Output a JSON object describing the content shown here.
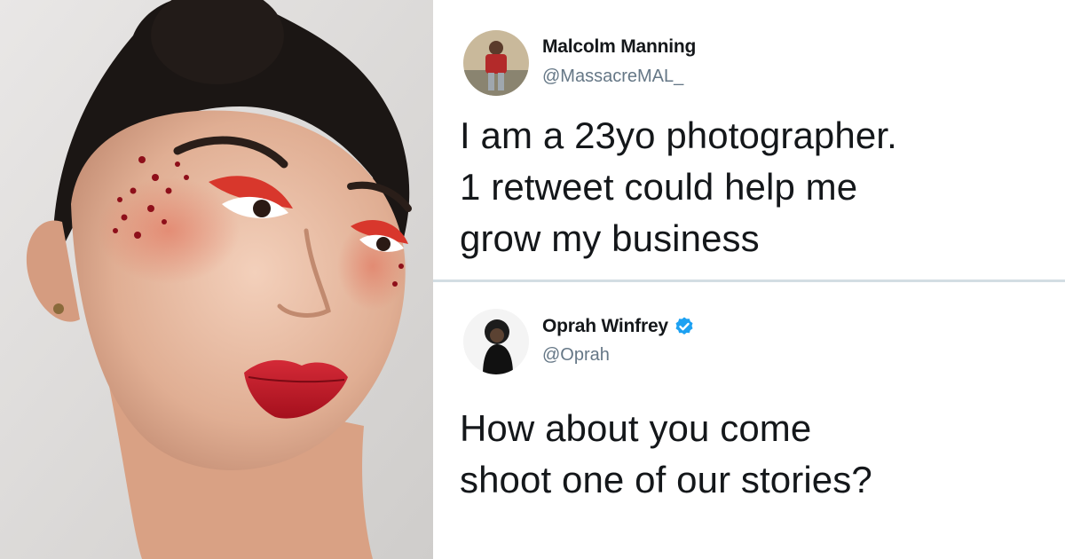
{
  "photo": {
    "description_icon": "portrait-photo"
  },
  "tweets": [
    {
      "display_name": "Malcolm Manning",
      "handle": "@MassacreMAL_",
      "verified": false,
      "text_lines": [
        "I am a 23yo photographer.",
        "1 retweet could help me",
        "grow my business"
      ]
    },
    {
      "display_name": "Oprah Winfrey",
      "handle": "@Oprah",
      "verified": true,
      "text_lines": [
        "How about you come",
        "shoot one of our stories?"
      ]
    }
  ],
  "colors": {
    "verified_badge": "#1da1f2",
    "divider": "#d3dde3",
    "text_primary": "#14171a",
    "text_secondary": "#657786",
    "lip_red": "#c8102e"
  }
}
